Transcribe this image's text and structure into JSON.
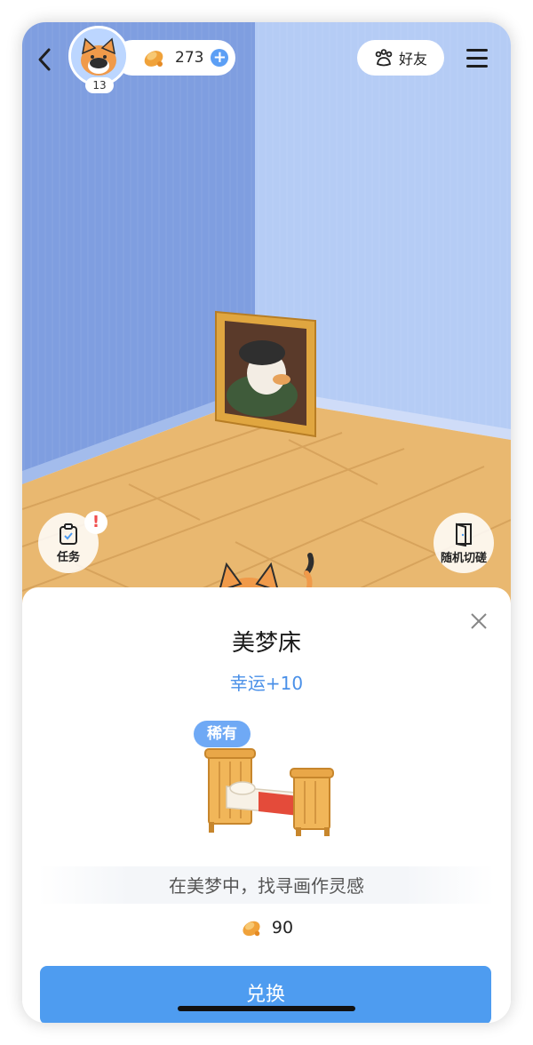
{
  "header": {
    "level": "13",
    "coins": "273",
    "friends_label": "好友"
  },
  "side_buttons": {
    "task_label": "任务",
    "task_alert": "!",
    "random_label": "随机切磋"
  },
  "item": {
    "name": "美梦床",
    "effect": "幸运+10",
    "rarity": "稀有",
    "description": "在美梦中，找寻画作灵感",
    "price": "90",
    "redeem_label": "兑换"
  },
  "colors": {
    "accent": "#4e9cf0",
    "effect_text": "#4a90e8",
    "rarity_badge": "#6fa9f5",
    "alert": "#f04d4d",
    "wall_left": "#7f9ee0",
    "wall_right": "#b5ccf5",
    "floor": "#e9b870"
  },
  "icons": {
    "back": "chevron-left-icon",
    "coin": "coin-icon",
    "plus": "plus-icon",
    "friends": "paw-icon",
    "menu": "menu-icon",
    "task": "clipboard-icon",
    "random": "door-icon",
    "close": "close-icon"
  }
}
